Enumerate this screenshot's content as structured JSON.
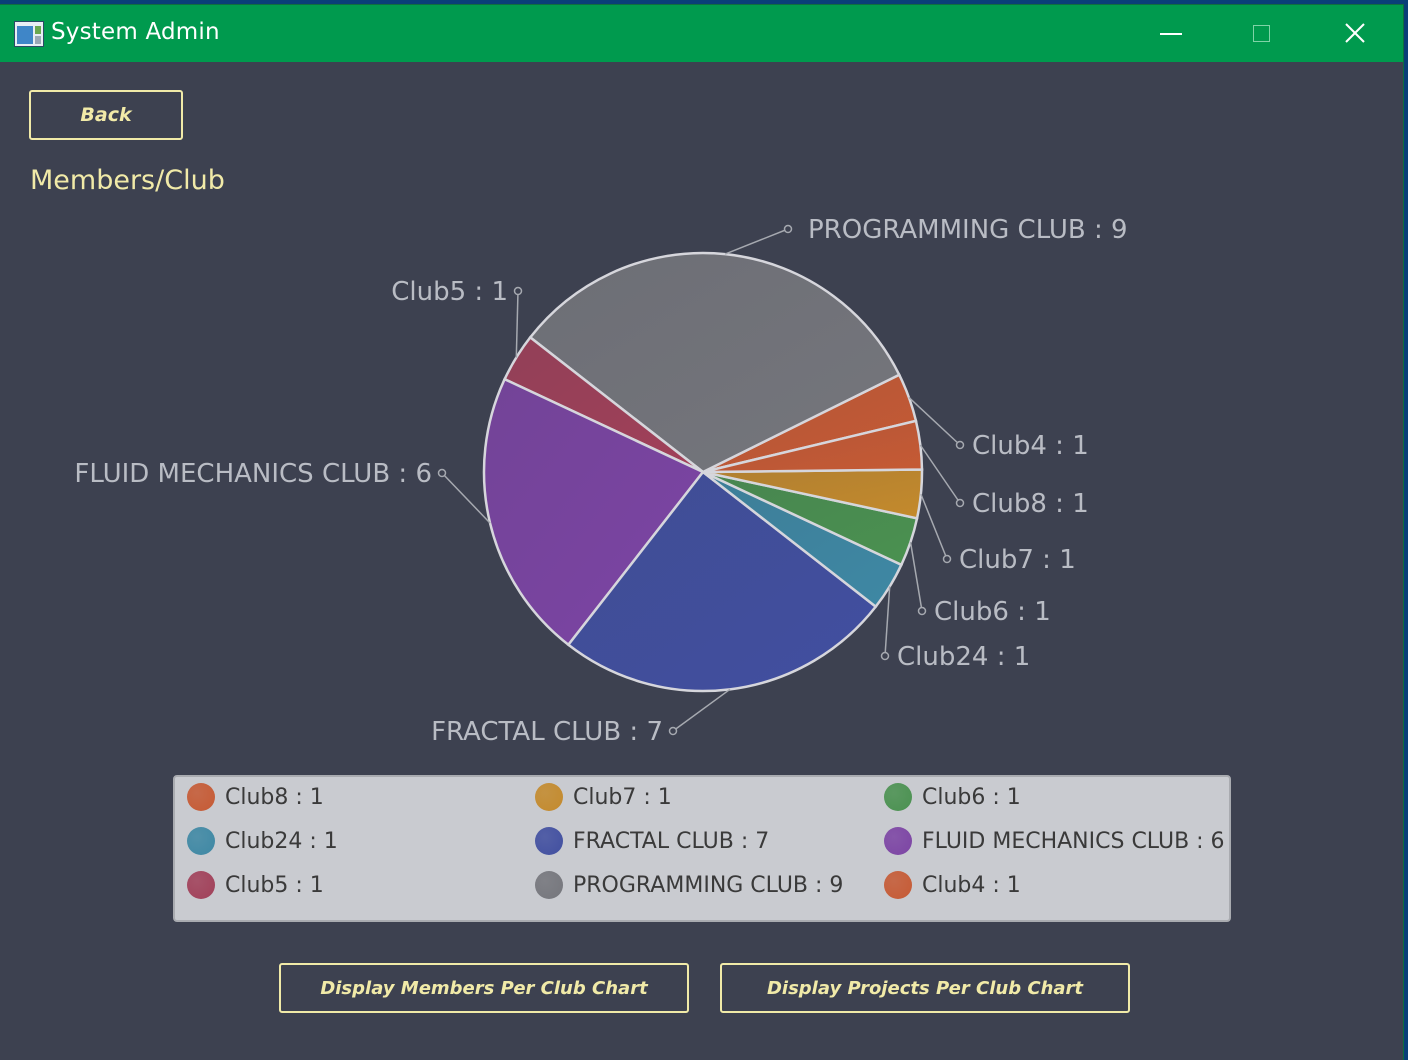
{
  "window": {
    "title": "System Admin",
    "controls": {
      "minimize": "minimize-icon",
      "maximize": "maximize-icon",
      "close": "close-icon"
    }
  },
  "toolbar": {
    "back_label": "Back"
  },
  "heading": "Members/Club",
  "chart_data": {
    "type": "pie",
    "title": "Members/Club",
    "slices": [
      {
        "name": "Club4",
        "value": 1,
        "label": "Club4 : 1",
        "color": "#c65a34"
      },
      {
        "name": "PROGRAMMING CLUB",
        "value": 9,
        "label": "PROGRAMMING CLUB : 9",
        "color": "#75767c"
      },
      {
        "name": "Club5",
        "value": 1,
        "label": "Club5 : 1",
        "color": "#a14059"
      },
      {
        "name": "FLUID MECHANICS CLUB",
        "value": 6,
        "label": "FLUID MECHANICS CLUB : 6",
        "color": "#7c44a4"
      },
      {
        "name": "FRACTAL CLUB",
        "value": 7,
        "label": "FRACTAL CLUB : 7",
        "color": "#414fa0"
      },
      {
        "name": "Club24",
        "value": 1,
        "label": "Club24 : 1",
        "color": "#3e88a4"
      },
      {
        "name": "Club6",
        "value": 1,
        "label": "Club6 : 1",
        "color": "#4a9150"
      },
      {
        "name": "Club7",
        "value": 1,
        "label": "Club7 : 1",
        "color": "#c48a2c"
      },
      {
        "name": "Club8",
        "value": 1,
        "label": "Club8 : 1",
        "color": "#c65a34"
      }
    ],
    "legend": {
      "placement": "bottom",
      "entries": [
        {
          "label": "Club8 : 1",
          "color": "#c65a34"
        },
        {
          "label": "Club7 : 1",
          "color": "#c48a2c"
        },
        {
          "label": "Club6 : 1",
          "color": "#4a9150"
        },
        {
          "label": "Club24 : 1",
          "color": "#3e88a4"
        },
        {
          "label": "FRACTAL CLUB : 7",
          "color": "#414fa0"
        },
        {
          "label": "FLUID MECHANICS CLUB : 6",
          "color": "#7c44a4"
        },
        {
          "label": "Club5 : 1",
          "color": "#a14059"
        },
        {
          "label": "PROGRAMMING CLUB : 9",
          "color": "#75767c"
        },
        {
          "label": "Club4 : 1",
          "color": "#c65a34"
        }
      ]
    }
  },
  "actions": {
    "members_chart_label": "Display Members Per Club Chart",
    "projects_chart_label": "Display Projects Per Club Chart"
  },
  "colors": {
    "titlebar": "#009a4e",
    "background": "#3d4150",
    "accent_text": "#f1eaa8",
    "chart_label": "#b9bcc4",
    "legend_background": "#c9cbd0"
  }
}
